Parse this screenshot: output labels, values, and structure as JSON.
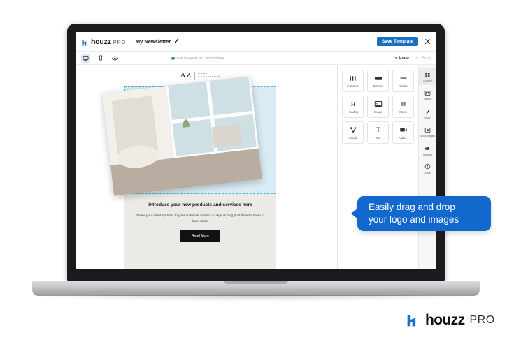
{
  "app": {
    "logo": {
      "word": "houzz",
      "pro": "PRO",
      "mark_color": "#1a73c8"
    },
    "document_title": "My Newsletter",
    "edit_icon": "pencil-icon",
    "save_button": "Save Template",
    "close_icon": "close-icon"
  },
  "toolbar": {
    "views": [
      {
        "name": "desktop-view",
        "icon": "desktop-icon",
        "active": true
      },
      {
        "name": "mobile-view",
        "icon": "mobile-icon",
        "active": false
      },
      {
        "name": "preview",
        "icon": "eye-icon",
        "active": false
      }
    ],
    "saved_status": "Last Saved 28 Oct, 2022 1:00pm",
    "saved_dot_color": "#2aa84a",
    "undo_label": "Undo",
    "redo_label": "Redo"
  },
  "email": {
    "brand_initials": "AZ",
    "brand_line1": "HOME",
    "brand_line2": "RENOVATION",
    "headline": "Introduce your new products and services here",
    "body": "Share your latest updates to your audience and link a page or blog post here for them to learn more!",
    "cta": "Read More",
    "dropzone_border_color": "#4fb3cf",
    "dropzone_fill_color": "#d9ecf5"
  },
  "panel": {
    "blocks": [
      {
        "label": "Columns",
        "icon": "columns-icon"
      },
      {
        "label": "Buttons",
        "icon": "button-icon"
      },
      {
        "label": "Divider",
        "icon": "divider-icon"
      },
      {
        "label": "Heading",
        "icon": "heading-icon"
      },
      {
        "label": "Image",
        "icon": "image-icon"
      },
      {
        "label": "Menu",
        "icon": "menu-icon"
      },
      {
        "label": "Social",
        "icon": "social-icon"
      },
      {
        "label": "Text",
        "icon": "text-icon"
      },
      {
        "label": "Video",
        "icon": "video-icon"
      }
    ],
    "tabs": [
      {
        "label": "Content",
        "icon": "content-icon",
        "active": true
      },
      {
        "label": "Blocks",
        "icon": "blocks-icon",
        "active": false
      },
      {
        "label": "Body",
        "icon": "body-icon",
        "active": false
      },
      {
        "label": "Stock Images",
        "icon": "stock-images-icon",
        "active": false
      },
      {
        "label": "Uploads",
        "icon": "uploads-icon",
        "active": false
      },
      {
        "label": "Audit",
        "icon": "audit-icon",
        "active": false
      }
    ]
  },
  "callout": {
    "line1": "Easily drag and drop",
    "line2": "your logo and images",
    "color": "#1268cc"
  },
  "brand": {
    "word": "houzz",
    "pro": "PRO",
    "mark_color": "#1a73c8"
  }
}
